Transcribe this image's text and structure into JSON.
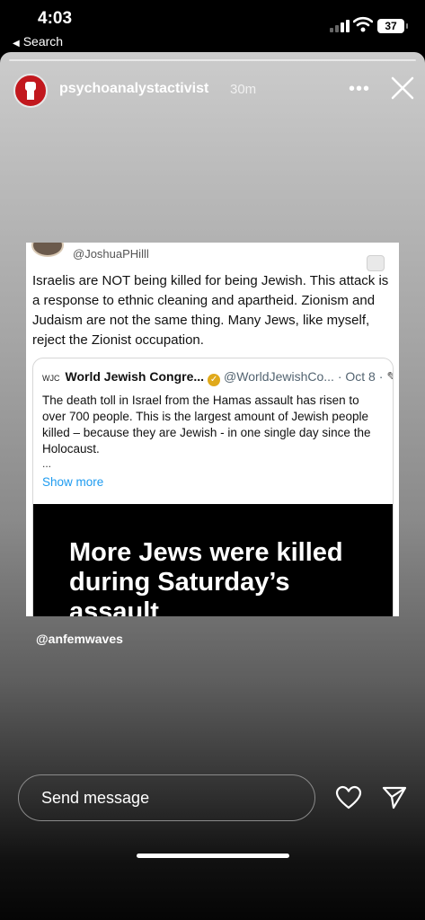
{
  "status_bar": {
    "time": "4:03",
    "back_label": "Search",
    "battery": "37"
  },
  "story": {
    "username": "psychoanalystactivist",
    "time_ago": "30m",
    "more_label": "•••",
    "mention": "@anfemwaves",
    "post": {
      "handle": "@JoshuaPHilll",
      "text": "Israelis are NOT being killed for being Jewish. This attack is a response to ethnic cleaning and apartheid. Zionism and Judaism are not the same thing. Many Jews, like myself, reject the Zionist occupation.",
      "quoted": {
        "org_logo": "WJC",
        "org_name": "World Jewish Congre...",
        "org_handle": "@WorldJewishCo...",
        "date": "· Oct 8 ·",
        "text": "The death toll in Israel from the Hamas assault has risen to over 700 people. This is the largest amount of Jewish people killed – because they are Jewish - in one single day since the Holocaust.",
        "ellipsis": "...",
        "show_more": "Show more",
        "image_headline": "More Jews were killed during Saturday’s assault"
      }
    }
  },
  "composer": {
    "placeholder": "Send message"
  },
  "colors": {
    "avatar_red": "#c2181e",
    "link_blue": "#1d9bf0",
    "verified_gold": "#e0a91b"
  }
}
